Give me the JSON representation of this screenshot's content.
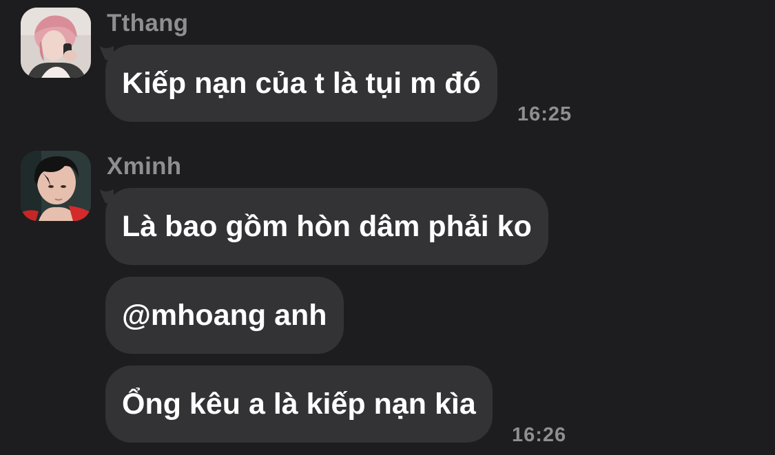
{
  "messages": [
    {
      "sender": "Tthang",
      "avatar_icon": "profile-photo-pink-hair",
      "bubbles": [
        {
          "text": "Kiếp nạn của t là tụi m đó"
        }
      ],
      "time": "16:25"
    },
    {
      "sender": "Xminh",
      "avatar_icon": "profile-photo-dark-hair",
      "bubbles": [
        {
          "text": "Là bao gồm hòn dâm phải ko"
        },
        {
          "text": "@mhoang anh"
        },
        {
          "text": "Ổng kêu a là kiếp nạn kìa"
        }
      ],
      "time": "16:26"
    }
  ],
  "colors": {
    "background": "#1d1d1f",
    "bubble": "#333335",
    "sender_name": "#8e8e93",
    "timestamp": "#8e8e93",
    "text": "#ffffff"
  }
}
